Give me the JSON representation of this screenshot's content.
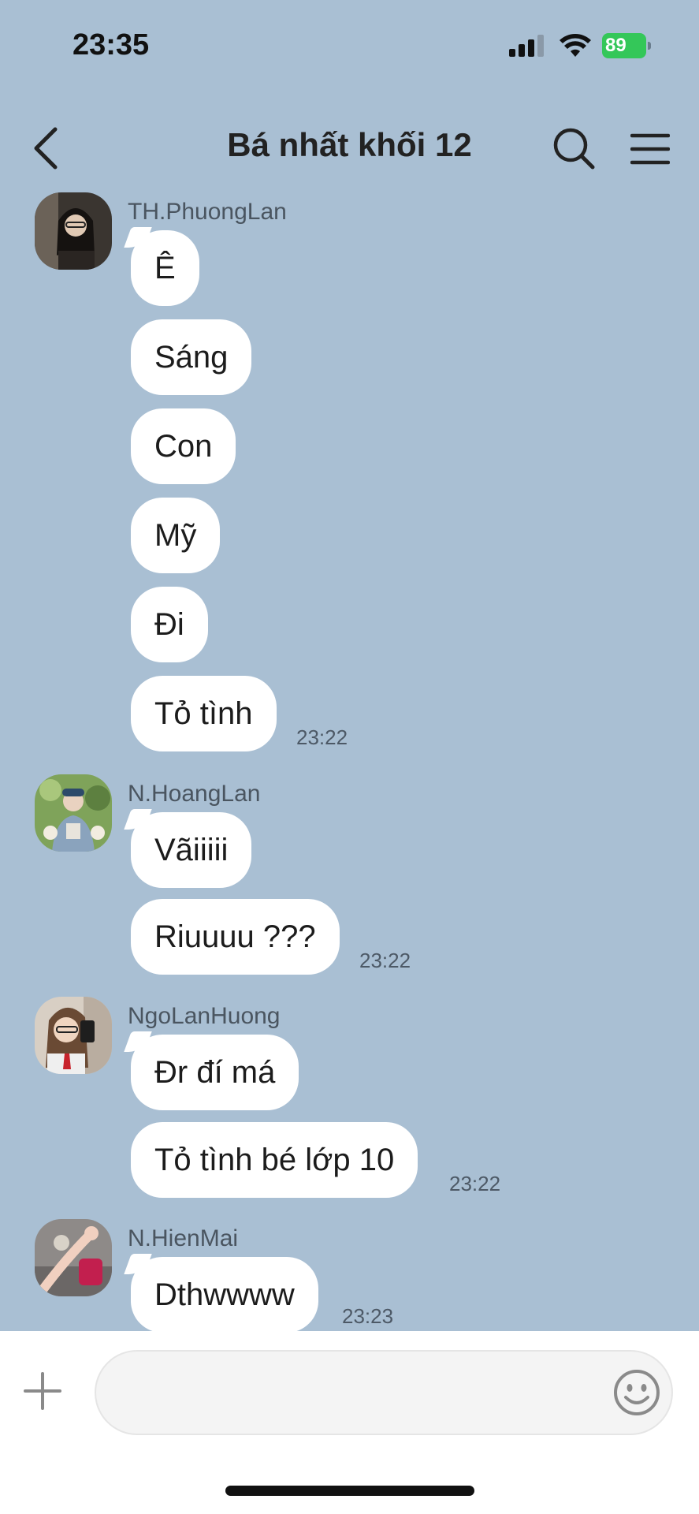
{
  "status": {
    "time": "23:35",
    "battery": "89"
  },
  "header": {
    "title": "Bá nhất khối 12"
  },
  "messages": [
    {
      "sender": "TH.PhuongLan",
      "texts": [
        "Ê",
        "Sáng",
        "Con",
        "Mỹ",
        "Đi",
        "Tỏ tình"
      ],
      "time": "23:22"
    },
    {
      "sender": "N.HoangLan",
      "texts": [
        "Vãiiiii",
        "Riuuuu ???"
      ],
      "time": "23:22"
    },
    {
      "sender": "NgoLanHuong",
      "texts": [
        "Đr đí má",
        "Tỏ tình bé lớp 10"
      ],
      "time": "23:22"
    },
    {
      "sender": "N.HienMai",
      "texts": [
        "Dthwwww"
      ],
      "time": "23:23"
    }
  ],
  "input": {
    "placeholder": ""
  },
  "icons": {
    "back": "chevron-left-icon",
    "search": "search-icon",
    "menu": "hamburger-menu-icon",
    "plus": "plus-icon",
    "emoji": "smiley-icon"
  },
  "colors": {
    "background": "#a9bfd3",
    "bubble": "#ffffff",
    "battery": "#34c759"
  }
}
